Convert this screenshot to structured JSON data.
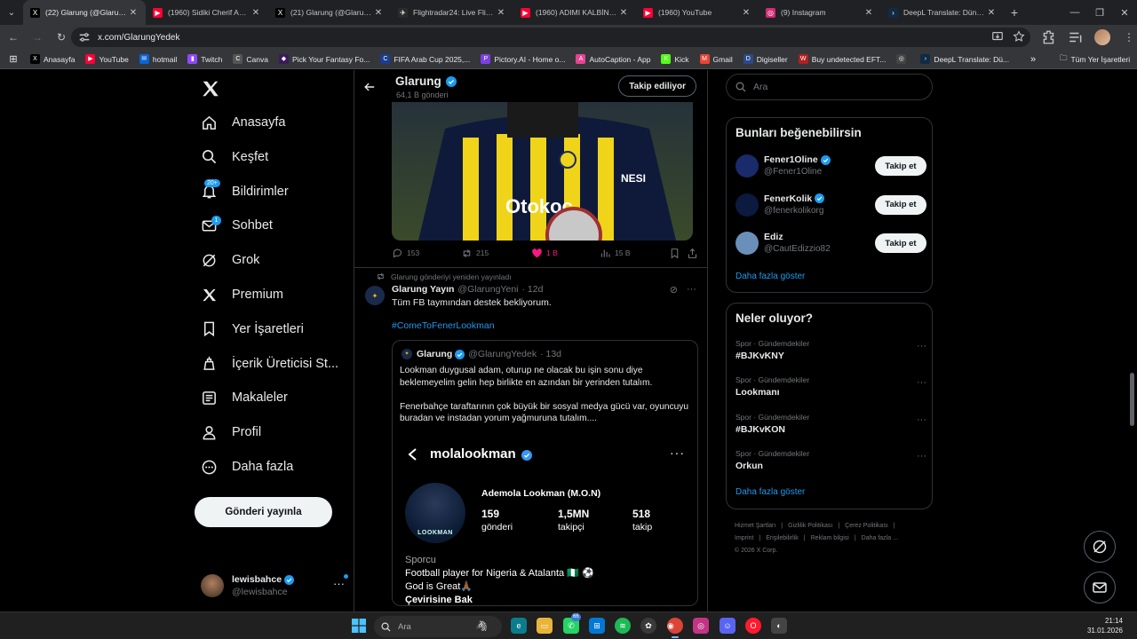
{
  "browser": {
    "tabs": [
      {
        "title": "(22) Glarung (@GlarungYedek)",
        "fav": "X",
        "color": "#000000",
        "active": true
      },
      {
        "title": "(1960) Sidiki Cherif Analiz",
        "fav": "▶",
        "color": "#ff0033",
        "active": false
      },
      {
        "title": "(21) Glarung (@GlarungYedek)",
        "fav": "X",
        "color": "#000000",
        "active": false
      },
      {
        "title": "Flightradar24: Live Flight",
        "fav": "✈",
        "color": "#2b2b2b",
        "active": false
      },
      {
        "title": "(1960) ADIMI KALBİNE YAZ",
        "fav": "▶",
        "color": "#ff0033",
        "active": false
      },
      {
        "title": "(1960) YouTube",
        "fav": "▶",
        "color": "#ff0033",
        "active": false
      },
      {
        "title": "(9) Instagram",
        "fav": "◎",
        "color": "#d62976",
        "active": false
      },
      {
        "title": "DeepL Translate: Dünyanın",
        "fav": "›",
        "color": "#0f2b46",
        "active": false
      }
    ],
    "url": "x.com/GlarungYedek",
    "bookmarks": [
      {
        "label": "Anasayfa",
        "fav": "X",
        "color": "#000000"
      },
      {
        "label": "YouTube",
        "fav": "▶",
        "color": "#ff0033"
      },
      {
        "label": "hotmail",
        "fav": "✉",
        "color": "#0a64d6"
      },
      {
        "label": "Twitch",
        "fav": "▮",
        "color": "#9146ff"
      },
      {
        "label": "Canva",
        "fav": "C",
        "color": "#555555"
      },
      {
        "label": "Pick Your Fantasy Fo...",
        "fav": "◆",
        "color": "#3a1a5a"
      },
      {
        "label": "FIFA Arab Cup 2025,...",
        "fav": "C",
        "color": "#1a3d8f"
      },
      {
        "label": "Pictory.AI - Home o...",
        "fav": "P",
        "color": "#7b3fe4"
      },
      {
        "label": "AutoCaption - App",
        "fav": "A",
        "color": "#e84393"
      },
      {
        "label": "Kick",
        "fav": "K",
        "color": "#53fc18"
      },
      {
        "label": "Gmail",
        "fav": "M",
        "color": "#ea4335"
      },
      {
        "label": "Digiseller",
        "fav": "D",
        "color": "#2b4a8a"
      },
      {
        "label": "Buy undetected EFT...",
        "fav": "W",
        "color": "#b02020"
      },
      {
        "label": "",
        "fav": "◎",
        "color": "#444444"
      },
      {
        "label": "DeepL Translate: Dü...",
        "fav": "›",
        "color": "#0f2b46"
      }
    ],
    "all_bookmarks": "Tüm Yer İşaretleri"
  },
  "nav": {
    "items": [
      {
        "label": "Anasayfa",
        "icon": "home-icon"
      },
      {
        "label": "Keşfet",
        "icon": "search-icon"
      },
      {
        "label": "Bildirimler",
        "icon": "bell-icon",
        "badge": "20+"
      },
      {
        "label": "Sohbet",
        "icon": "mail-icon",
        "badge": "1"
      },
      {
        "label": "Grok",
        "icon": "grok-icon"
      },
      {
        "label": "Premium",
        "icon": "x-logo-icon"
      },
      {
        "label": "Yer İşaretleri",
        "icon": "bookmark-icon"
      },
      {
        "label": "İçerik Üreticisi St...",
        "icon": "creator-icon"
      },
      {
        "label": "Makaleler",
        "icon": "article-icon"
      },
      {
        "label": "Profil",
        "icon": "user-icon"
      },
      {
        "label": "Daha fazla",
        "icon": "more-circle-icon"
      }
    ],
    "post_button": "Gönderi yayınla",
    "account": {
      "name": "lewisbahce",
      "handle": "@lewisbahce"
    }
  },
  "profile_header": {
    "name": "Glarung",
    "count": "64,1 B gönderi",
    "follow_state": "Takip ediliyor"
  },
  "tweet1": {
    "replies": "153",
    "reposts": "215",
    "likes": "1 B",
    "views": "15 B"
  },
  "tweet2": {
    "repost_context": "Glarung gönderiyi yeniden yayınladı",
    "author": "Glarung Yayın",
    "handle": "@GlarungYeni",
    "time": "· 12d",
    "text": "Tüm FB taymından destek bekliyorum.",
    "hashtag": "#ComeToFenerLookman",
    "quote": {
      "author": "Glarung",
      "handle": "@GlarungYedek",
      "time": "· 13d",
      "p1": "Lookman duygusal adam, oturup ne olacak bu işin sonu diye beklemeyelim gelin hep birlikte en azından bir yerinden tutalım.",
      "p2": "Fenerbahçe taraftarının çok büyük bir sosyal medya gücü var, oyuncuyu buradan ve instadan yorum yağmuruna tutalım....",
      "insta": {
        "username": "molalookman",
        "fullname": "Ademola Lookman (M.O.N)",
        "stats": [
          {
            "n": "159",
            "l": "gönderi"
          },
          {
            "n": "1,5MN",
            "l": "takipçi"
          },
          {
            "n": "518",
            "l": "takip"
          }
        ],
        "category": "Sporcu",
        "bio1": "Football player for Nigeria & Atalanta 🇳🇬 ⚽",
        "bio2": "God is Great🙏🏾",
        "translate": "Çevirisine Bak",
        "pic_text": "LOOKMAN"
      }
    }
  },
  "right": {
    "search_placeholder": "Ara",
    "wtf_title": "Bunları beğenebilirsin",
    "suggestions": [
      {
        "name": "Fener1Oline",
        "handle": "@Fener1Oline",
        "button": "Takip et",
        "color": "#1a2a6a",
        "verified": true
      },
      {
        "name": "FenerKolik",
        "handle": "@fenerkolikorg",
        "button": "Takip et",
        "color": "#0c1a40",
        "verified": true
      },
      {
        "name": "Ediz",
        "handle": "@CautEdizzio82",
        "button": "Takip et",
        "color": "#6a8fb8",
        "verified": false
      }
    ],
    "show_more": "Daha fazla göster",
    "trends_title": "Neler oluyor?",
    "trends": [
      {
        "category": "Spor · Gündemdekiler",
        "name": "#BJKvKNY"
      },
      {
        "category": "Spor · Gündemdekiler",
        "name": "Lookmanı"
      },
      {
        "category": "Spor · Gündemdekiler",
        "name": "#BJKvKON"
      },
      {
        "category": "Spor · Gündemdekiler",
        "name": "Orkun"
      }
    ],
    "footer": [
      "Hizmet Şartları",
      "|",
      "Gizlilik Politikası",
      "|",
      "Çerez Politikası",
      "|",
      "Imprint",
      "|",
      "Erişilebilirlik",
      "|",
      "Reklam bilgisi",
      "|",
      "Daha fazla ...",
      "© 2026 X Corp."
    ]
  },
  "taskbar": {
    "search": "Ara",
    "time": "21:14",
    "date": "31.01.2026",
    "whatsapp_badge": "66"
  }
}
